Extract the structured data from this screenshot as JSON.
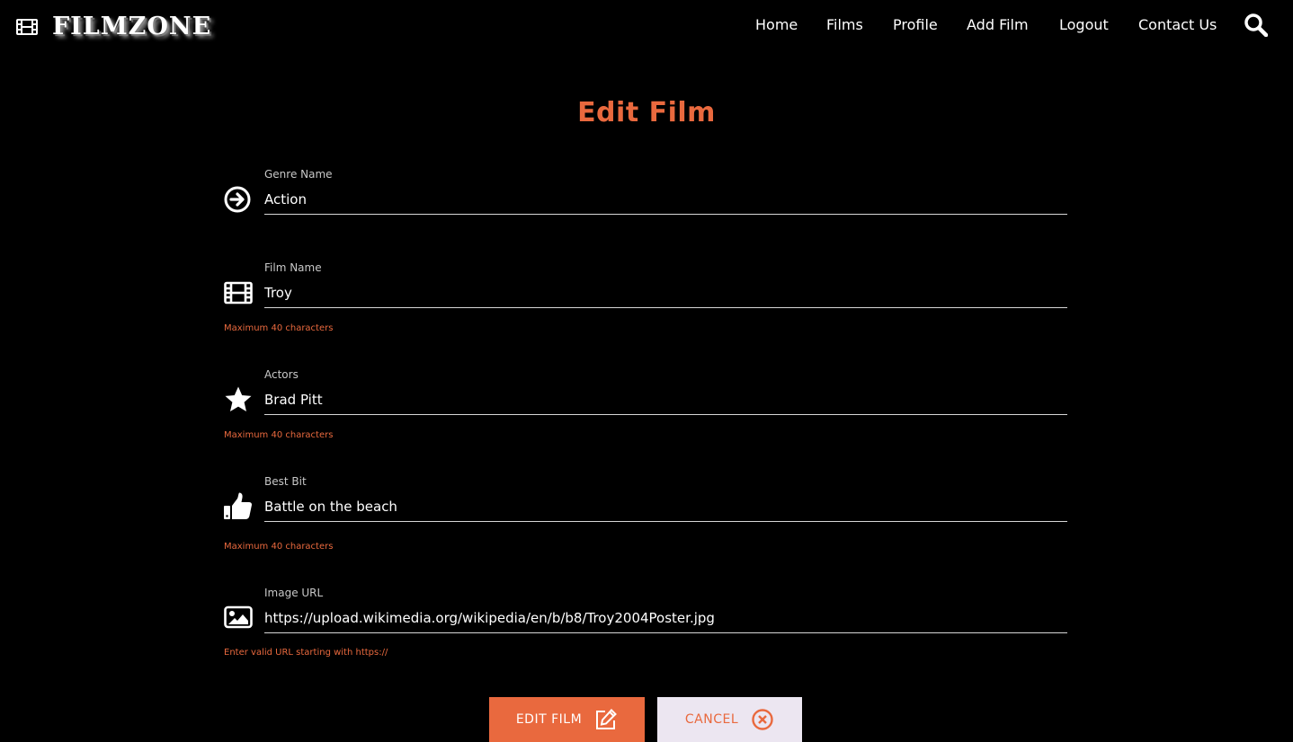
{
  "brand": {
    "name": "FILMZONE",
    "icon": "film-icon"
  },
  "nav": {
    "items": [
      {
        "label": "Home"
      },
      {
        "label": "Films"
      },
      {
        "label": "Profile"
      },
      {
        "label": "Add Film"
      },
      {
        "label": "Logout"
      },
      {
        "label": "Contact Us"
      }
    ],
    "search_icon": "search-icon"
  },
  "page": {
    "title": "Edit Film"
  },
  "form": {
    "genre": {
      "label": "Genre Name",
      "value": "Action",
      "icon": "arrow-circle-right-icon"
    },
    "film_name": {
      "label": "Film Name",
      "value": "Troy",
      "hint": "Maximum 40 characters",
      "icon": "film-icon"
    },
    "actors": {
      "label": "Actors",
      "value": "Brad Pitt",
      "hint": "Maximum 40 characters",
      "icon": "star-icon"
    },
    "best_bit": {
      "label": "Best Bit",
      "value": "Battle on the beach",
      "hint": "Maximum 40 characters",
      "icon": "thumbs-up-icon"
    },
    "image_url": {
      "label": "Image URL",
      "value": "https://upload.wikimedia.org/wikipedia/en/b/b8/Troy2004Poster.jpg",
      "hint": "Enter valid URL starting with https://",
      "icon": "image-icon"
    }
  },
  "buttons": {
    "edit": {
      "label": "EDIT FILM",
      "icon": "edit-icon"
    },
    "cancel": {
      "label": "CANCEL",
      "icon": "close-circle-icon"
    }
  },
  "colors": {
    "accent": "#e9693e",
    "background": "#000000",
    "cancel_bg": "#ece6f1"
  }
}
